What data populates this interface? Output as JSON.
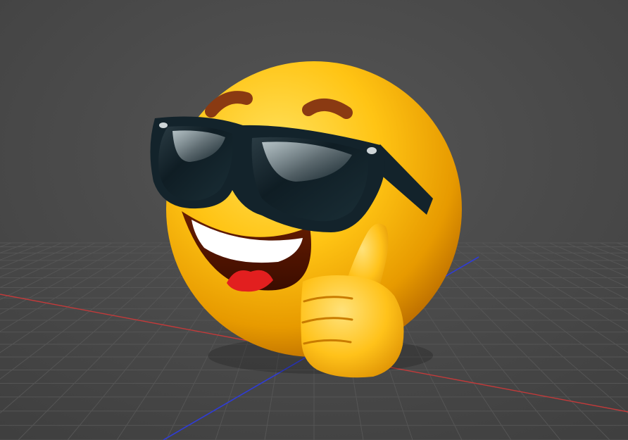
{
  "viewport": {
    "background_color": "#3d3d3d",
    "grid_line_color": "#555555",
    "axis_x_color": "#c23a3a",
    "axis_y_color": "#2f3cd6"
  },
  "model": {
    "icon": "sunglasses-thumbs-up-emoji-icon",
    "face_color": "#f5b800",
    "sunglasses_frame_color": "#13232b",
    "eyebrow_color": "#8a3a12"
  }
}
